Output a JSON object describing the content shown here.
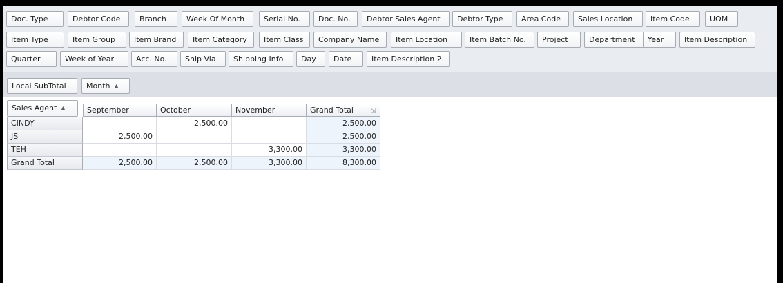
{
  "available_fields": {
    "row0": [
      "Doc. Type",
      "Debtor Code",
      "Branch",
      "Week Of Month",
      "Serial No.",
      "Doc. No.",
      "Debtor Sales Agent",
      "Debtor Type",
      "Area Code",
      "Sales Location",
      "Item Code",
      "UOM"
    ],
    "row1": [
      "Item Type",
      "Item Group",
      "Item Brand",
      "Item Category",
      "Item Class",
      "Company Name",
      "Item Location",
      "Item Batch No.",
      "Project",
      "Department",
      "Year",
      "Item Description"
    ],
    "row2": [
      "Quarter",
      "Week of Year",
      "Acc. No.",
      "Ship Via",
      "Shipping Info",
      "Day",
      "Date",
      "Item Description 2"
    ]
  },
  "data_header": {
    "data_field": "Local SubTotal",
    "column_field": "Month"
  },
  "grid": {
    "row_field": "Sales Agent",
    "columns": [
      "September",
      "October",
      "November",
      "Grand Total"
    ],
    "rows": [
      {
        "label": "CINDY",
        "values": [
          "",
          "2,500.00",
          "",
          "2,500.00"
        ]
      },
      {
        "label": "JS",
        "values": [
          "2,500.00",
          "",
          "",
          "2,500.00"
        ]
      },
      {
        "label": "TEH",
        "values": [
          "",
          "",
          "3,300.00",
          "3,300.00"
        ]
      }
    ],
    "grand_total": {
      "label": "Grand Total",
      "values": [
        "2,500.00",
        "2,500.00",
        "3,300.00",
        "8,300.00"
      ]
    }
  }
}
